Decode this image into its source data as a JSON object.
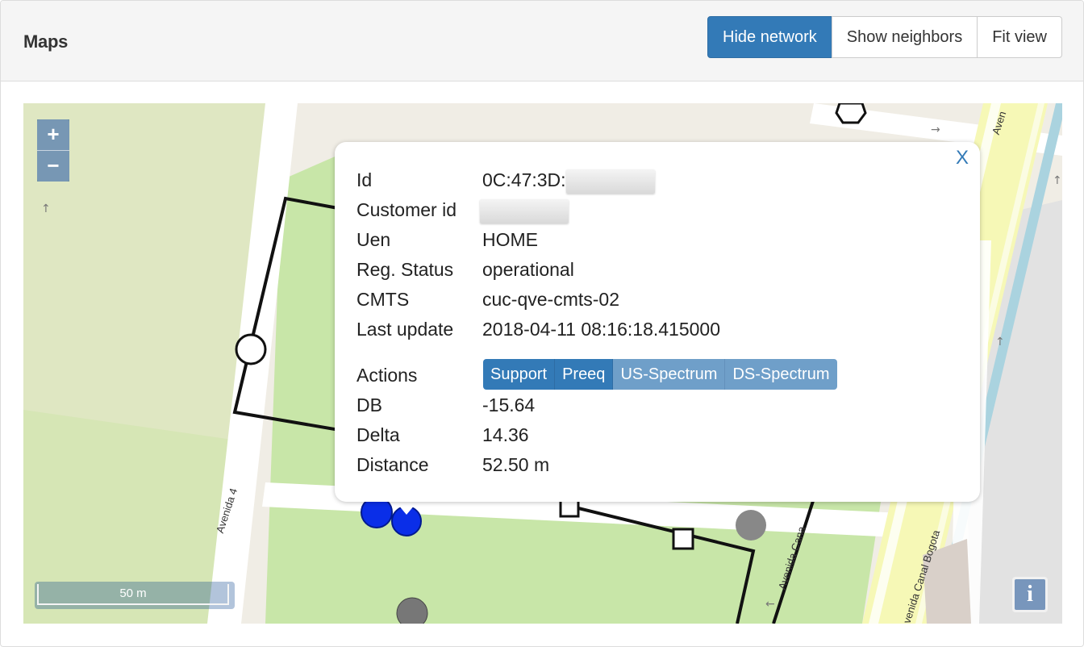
{
  "header": {
    "title": "Maps",
    "buttons": {
      "hide_network": "Hide network",
      "show_neighbors": "Show neighbors",
      "fit_view": "Fit view"
    }
  },
  "map": {
    "zoom_in": "+",
    "zoom_out": "−",
    "scale_label": "50 m",
    "info_label": "i",
    "street_labels": [
      "Avenida 4",
      "Avenida Cana",
      "Avenida Canal Bogota",
      "Aven"
    ]
  },
  "popup": {
    "close_label": "X",
    "fields": {
      "id": {
        "label": "Id",
        "value": "0C:47:3D:"
      },
      "customer_id": {
        "label": "Customer id",
        "value": ""
      },
      "uen": {
        "label": "Uen",
        "value": "HOME"
      },
      "reg_status": {
        "label": "Reg. Status",
        "value": "operational"
      },
      "cmts": {
        "label": "CMTS",
        "value": "cuc-qve-cmts-02"
      },
      "last_update": {
        "label": "Last update",
        "value": "2018-04-11 08:16:18.415000"
      },
      "db": {
        "label": "DB",
        "value": "-15.64"
      },
      "delta": {
        "label": "Delta",
        "value": "14.36"
      },
      "distance": {
        "label": "Distance",
        "value": "52.50 m"
      }
    },
    "actions_label": "Actions",
    "actions": {
      "support": "Support",
      "preeq": "Preeq",
      "us_spectrum": "US-Spectrum",
      "ds_spectrum": "DS-Spectrum"
    }
  },
  "colors": {
    "primary": "#337ab7",
    "park": "#c8e6a8",
    "road": "#ffffff",
    "canal_road": "#f6f8b6",
    "network_line": "#111111"
  }
}
